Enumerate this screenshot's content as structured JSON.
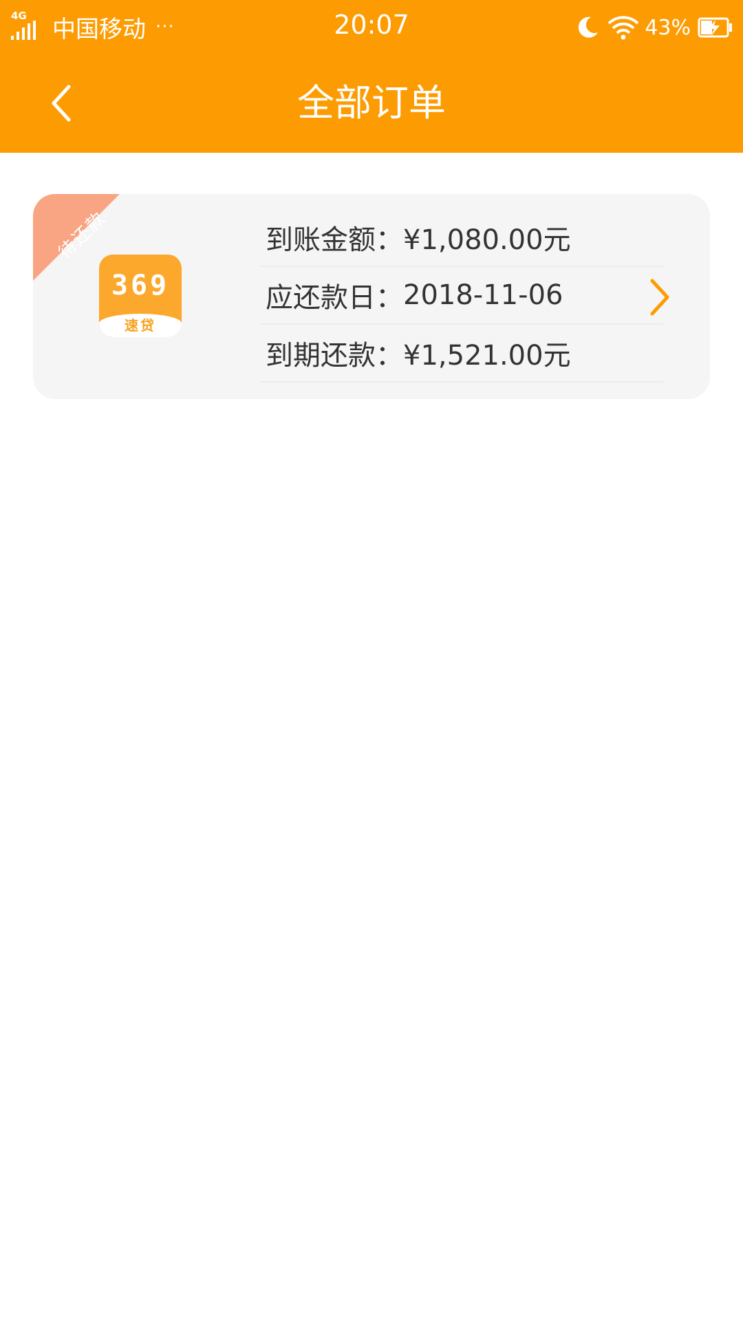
{
  "status_bar": {
    "network_type": "4G",
    "carrier": "中国移动",
    "more": "···",
    "time": "20:07",
    "battery_percent": "43%",
    "icons": [
      "signal-icon",
      "moon-icon",
      "wifi-icon",
      "battery-charging-icon"
    ]
  },
  "nav": {
    "title": "全部订单",
    "back_icon": "chevron-left-icon"
  },
  "orders": [
    {
      "status": "待还款",
      "logo": {
        "digits": "369",
        "word": "速贷"
      },
      "received_amount": {
        "label": "到账金额：",
        "value": "¥1,080.00元"
      },
      "due_date": {
        "label": "应还款日：",
        "value": "2018-11-06"
      },
      "repayment_amount": {
        "label": "到期还款：",
        "value": "¥1,521.00元"
      },
      "arrow_icon": "chevron-right-icon"
    }
  ],
  "colors": {
    "accent": "#fc9c02",
    "ribbon": "#f9a482",
    "card_background": "#f5f5f5",
    "text": "#333333"
  }
}
